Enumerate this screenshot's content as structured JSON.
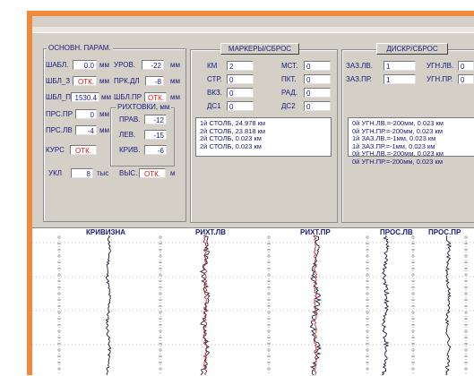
{
  "main_params": {
    "title": "ОСНОВН. ПАРАМ.",
    "rows": [
      {
        "label": "ШАБЛ.",
        "value": "0.0",
        "unit": "мм",
        "alert": false
      },
      {
        "label": "ШБЛ_З",
        "value": "ОТК.",
        "unit": "мм",
        "alert": true
      },
      {
        "label": "ШБЛ_П",
        "value": "1530.4",
        "unit": "мм",
        "alert": false
      }
    ],
    "level_rows": [
      {
        "label": "УРОВ.",
        "value": "-22",
        "unit": "мм",
        "alert": false
      },
      {
        "label": "ПРК.ДЛ",
        "value": "-8",
        "unit": "мм",
        "alert": false
      },
      {
        "label": "ШБЛ.ПР",
        "value": "ОТК.",
        "unit": "мм",
        "alert": true
      }
    ],
    "pros_rows": [
      {
        "label": "ПРС.ПР",
        "value": "0",
        "unit": "мм",
        "alert": false
      },
      {
        "label": "ПРС.ЛВ",
        "value": "-4",
        "unit": "мм",
        "alert": false
      }
    ],
    "kurs_label": "КУРС",
    "kurs_value": "ОТК.",
    "ukl_label": "УКЛ",
    "ukl_value": "8",
    "ukl_unit": "тыс",
    "vys_label": "ВЫС.",
    "vys_value": "ОТК.",
    "vys_unit": "м"
  },
  "rikhtovki": {
    "title": "РИХТОВКИ, мм",
    "rows": [
      {
        "label": "ПРАВ.",
        "value": "-12"
      },
      {
        "label": "ЛЕВ.",
        "value": "-15"
      },
      {
        "label": "КРИВ.",
        "value": "-6"
      }
    ]
  },
  "markers": {
    "button": "МАРКЕРЫ/СБРОС",
    "left": [
      {
        "label": "КМ",
        "value": "2"
      },
      {
        "label": "СТР.",
        "value": "0"
      },
      {
        "label": "ВКЗ.",
        "value": "0"
      },
      {
        "label": "ДС1",
        "value": "0"
      }
    ],
    "right": [
      {
        "label": "МСТ.",
        "value": "0"
      },
      {
        "label": "ПКТ.",
        "value": "0"
      },
      {
        "label": "РАД.",
        "value": "0"
      },
      {
        "label": "ДС2",
        "value": "0"
      }
    ],
    "log": [
      "1й СТОЛБ, 24.978 км",
      "2й СТОЛБ, 23.818 км",
      "2й СТОЛБ, 0.023 км",
      "2й СТОЛБ, 0.023 км"
    ]
  },
  "discr": {
    "button": "ДИСКР/СБРОС",
    "rows": [
      {
        "label": "ЗАЗ.ЛВ.",
        "value": "1",
        "label2": "УГН.ЛВ.",
        "value2": "0"
      },
      {
        "label": "ЗАЗ.ПР.",
        "value": "1",
        "label2": "УГН.ПР.",
        "value2": "0"
      }
    ],
    "log": [
      "0й УГН.ЛВ.=-200мм, 0.023 км",
      "0й УГН.ПР.=-200мм, 0.023 км",
      "1й ЗАЗ.ЛВ.=-1мм, 0.023 км",
      "1й ЗАЗ.ПР.=-1мм, 0.023 км",
      "0й УГН.ЛВ.=-200мм, 0.023 км",
      "0й УГН.ПР.=-200мм, 0.023 км"
    ]
  },
  "graph": {
    "columns": [
      "КРИВИЗНА",
      "РИХТ.ЛВ",
      "РИХТ.ПР",
      "ПРОС.ЛВ",
      "ПРОС.ПР"
    ]
  },
  "colors": {
    "accent": "#f08a3a",
    "panel": "#d4d0c8",
    "text": "#1a1a7a",
    "alert": "#e01010"
  }
}
